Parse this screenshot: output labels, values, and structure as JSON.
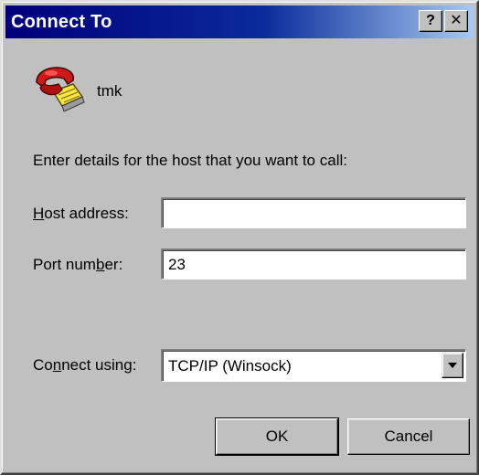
{
  "window": {
    "title": "Connect To",
    "help_label": "?",
    "close_label": "✕"
  },
  "connection": {
    "name": "tmk",
    "icon": "telephone-icon"
  },
  "form": {
    "instructions": "Enter details for the host that you want to call:",
    "host": {
      "label_pre": "",
      "label_accel": "H",
      "label_post": "ost address:",
      "value": ""
    },
    "port": {
      "label_pre": "Port num",
      "label_accel": "b",
      "label_post": "er:",
      "value": "23"
    },
    "connect": {
      "label_pre": "Co",
      "label_accel": "n",
      "label_post": "nect using:",
      "value": "TCP/IP (Winsock)"
    }
  },
  "buttons": {
    "ok": "OK",
    "cancel": "Cancel"
  },
  "colors": {
    "title_start": "#00007b",
    "title_end": "#a6caf0",
    "face": "#c0c0c0"
  }
}
